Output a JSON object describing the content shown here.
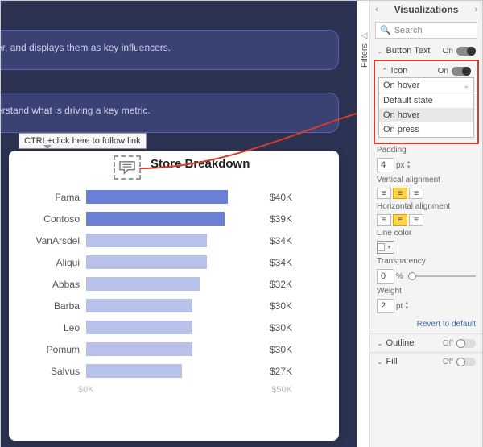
{
  "canvas": {
    "card1_text": "hatter, and displays them as key influencers.",
    "card2_text": "understand what is driving a key metric.",
    "tooltip": "CTRL+click here to follow link"
  },
  "chart_data": {
    "type": "bar",
    "title": "Store Breakdown",
    "categories": [
      "Fama",
      "Contoso",
      "VanArsdel",
      "Aliqui",
      "Abbas",
      "Barba",
      "Leo",
      "Pomum",
      "Salvus"
    ],
    "values": [
      40,
      39,
      34,
      34,
      32,
      30,
      30,
      30,
      27
    ],
    "value_labels": [
      "$40K",
      "$39K",
      "$34K",
      "$34K",
      "$32K",
      "$30K",
      "$30K",
      "$30K",
      "$27K"
    ],
    "fill": [
      "#6a7fd6",
      "#6a7fd6",
      "#b7c1e9",
      "#b7c1e9",
      "#b7c1e9",
      "#b7c1e9",
      "#b7c1e9",
      "#b7c1e9",
      "#b7c1e9"
    ],
    "xaxis_ticks": [
      "$0K",
      "$50K"
    ],
    "xlim": [
      0,
      50
    ]
  },
  "filters_tab": {
    "label": "Filters"
  },
  "pane": {
    "title": "Visualizations",
    "search_placeholder": "Search",
    "button_text": {
      "label": "Button Text",
      "state": "On"
    },
    "icon": {
      "label": "Icon",
      "state": "On",
      "dropdown_value": "On hover",
      "dropdown_options": [
        "Default state",
        "On hover",
        "On press"
      ],
      "padding_label": "Padding",
      "padding_value": "4",
      "padding_unit": "px",
      "valign_label": "Vertical alignment",
      "halign_label": "Horizontal alignment",
      "linecolor_label": "Line color",
      "transparency_label": "Transparency",
      "transparency_value": "0",
      "transparency_unit": "%",
      "weight_label": "Weight",
      "weight_value": "2",
      "weight_unit": "pt",
      "revert": "Revert to default"
    },
    "outline": {
      "label": "Outline",
      "state": "Off"
    },
    "fill": {
      "label": "Fill",
      "state": "Off"
    }
  }
}
